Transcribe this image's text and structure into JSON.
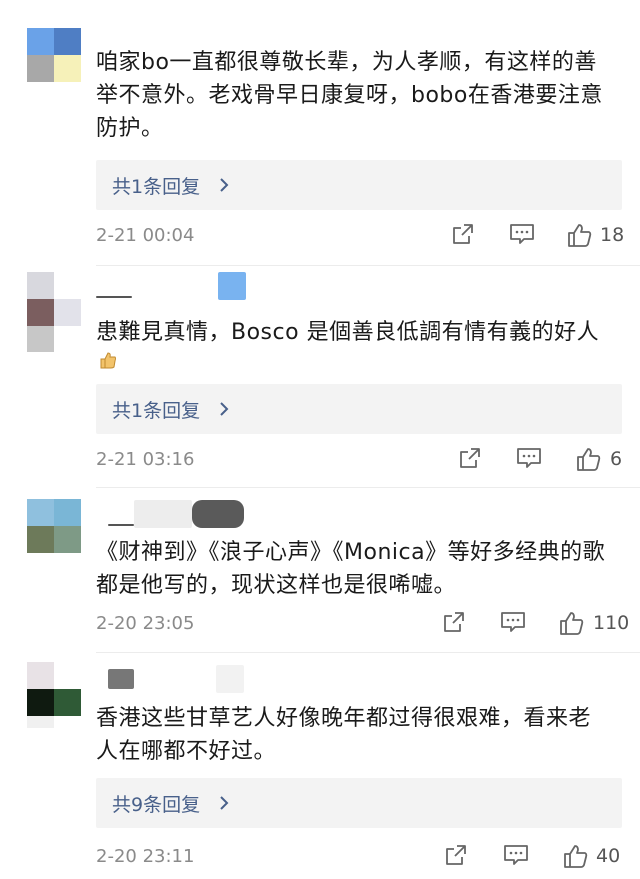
{
  "comments": [
    {
      "lines": [
        "咱家bo一直都很尊敬长辈，为人孝顺，有这样的善",
        "举不意外。老戏骨早日康复呀，bobo在香港要注意",
        "防护。"
      ],
      "reply_label": "共1条回复",
      "time": "2-21 00:04",
      "likes": "18"
    },
    {
      "lines": [
        "患難見真情，Bosco 是個善良低調有情有義的好人"
      ],
      "reply_label": "共1条回复",
      "time": "2-21 03:16",
      "likes": "6"
    },
    {
      "lines": [
        "《财神到》《浪子心声》《Monica》等好多经典的歌",
        "都是他写的，现状这样也是很唏嘘。"
      ],
      "time": "2-20 23:05",
      "likes": "110"
    },
    {
      "lines": [
        "香港这些甘草艺人好像晚年都过得很艰难，看来老",
        "人在哪都不好过。"
      ],
      "reply_label": "共9条回复",
      "time": "2-20 23:11",
      "likes": "40"
    }
  ],
  "icons": {
    "share": "share-icon",
    "comment": "comment-icon",
    "like": "thumbs-up-icon",
    "chevron": "chevron-right-icon",
    "emoji": "thumbs-up-emoji"
  },
  "colors": {
    "text": "#1a1a1a",
    "reply_link": "#48608a",
    "meta": "#8a8a8a",
    "reply_bg": "#f3f3f3"
  }
}
